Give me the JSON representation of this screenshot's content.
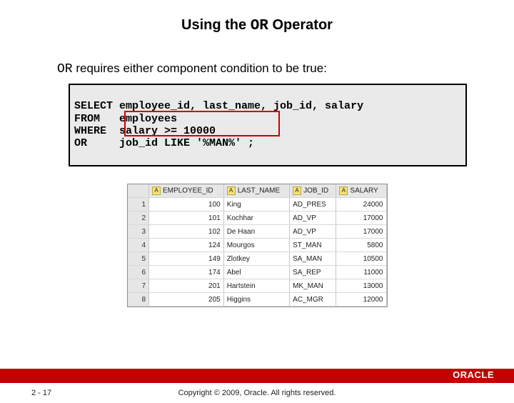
{
  "title_pre": "Using the ",
  "title_mono": "OR",
  "title_post": " Operator",
  "subtitle_mono": "OR",
  "subtitle_rest": " requires either component condition to be true:",
  "sql": {
    "l1": "SELECT employee_id, last_name, job_id, salary",
    "l2": "FROM   employees",
    "l3": "WHERE  salary >= 10000",
    "l4": "OR     job_id LIKE '%MAN%' ;"
  },
  "columns": [
    "EMPLOYEE_ID",
    "LAST_NAME",
    "JOB_ID",
    "SALARY"
  ],
  "rows": [
    {
      "n": "1",
      "emp": "100",
      "name": "King",
      "job": "AD_PRES",
      "sal": "24000"
    },
    {
      "n": "2",
      "emp": "101",
      "name": "Kochhar",
      "job": "AD_VP",
      "sal": "17000"
    },
    {
      "n": "3",
      "emp": "102",
      "name": "De Haan",
      "job": "AD_VP",
      "sal": "17000"
    },
    {
      "n": "4",
      "emp": "124",
      "name": "Mourgos",
      "job": "ST_MAN",
      "sal": "5800"
    },
    {
      "n": "5",
      "emp": "149",
      "name": "Zlotkey",
      "job": "SA_MAN",
      "sal": "10500"
    },
    {
      "n": "6",
      "emp": "174",
      "name": "Abel",
      "job": "SA_REP",
      "sal": "11000"
    },
    {
      "n": "7",
      "emp": "201",
      "name": "Hartstein",
      "job": "MK_MAN",
      "sal": "13000"
    },
    {
      "n": "8",
      "emp": "205",
      "name": "Higgins",
      "job": "AC_MGR",
      "sal": "12000"
    }
  ],
  "page": "2 - 17",
  "copyright": "Copyright © 2009, Oracle. All rights reserved.",
  "logo": "ORACLE"
}
